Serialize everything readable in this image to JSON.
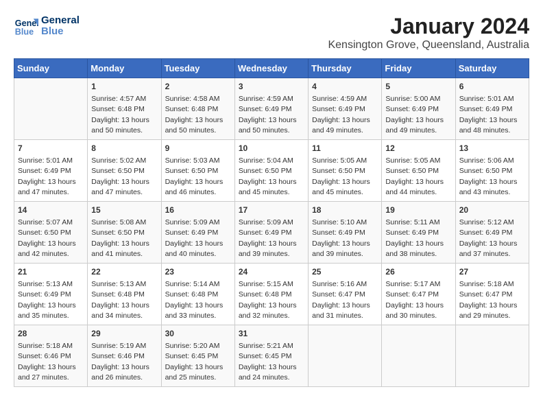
{
  "logo": {
    "line1": "General",
    "line2": "Blue"
  },
  "title": "January 2024",
  "subtitle": "Kensington Grove, Queensland, Australia",
  "weekdays": [
    "Sunday",
    "Monday",
    "Tuesday",
    "Wednesday",
    "Thursday",
    "Friday",
    "Saturday"
  ],
  "weeks": [
    [
      {
        "day": "",
        "info": ""
      },
      {
        "day": "1",
        "info": "Sunrise: 4:57 AM\nSunset: 6:48 PM\nDaylight: 13 hours\nand 50 minutes."
      },
      {
        "day": "2",
        "info": "Sunrise: 4:58 AM\nSunset: 6:48 PM\nDaylight: 13 hours\nand 50 minutes."
      },
      {
        "day": "3",
        "info": "Sunrise: 4:59 AM\nSunset: 6:49 PM\nDaylight: 13 hours\nand 50 minutes."
      },
      {
        "day": "4",
        "info": "Sunrise: 4:59 AM\nSunset: 6:49 PM\nDaylight: 13 hours\nand 49 minutes."
      },
      {
        "day": "5",
        "info": "Sunrise: 5:00 AM\nSunset: 6:49 PM\nDaylight: 13 hours\nand 49 minutes."
      },
      {
        "day": "6",
        "info": "Sunrise: 5:01 AM\nSunset: 6:49 PM\nDaylight: 13 hours\nand 48 minutes."
      }
    ],
    [
      {
        "day": "7",
        "info": "Sunrise: 5:01 AM\nSunset: 6:49 PM\nDaylight: 13 hours\nand 47 minutes."
      },
      {
        "day": "8",
        "info": "Sunrise: 5:02 AM\nSunset: 6:50 PM\nDaylight: 13 hours\nand 47 minutes."
      },
      {
        "day": "9",
        "info": "Sunrise: 5:03 AM\nSunset: 6:50 PM\nDaylight: 13 hours\nand 46 minutes."
      },
      {
        "day": "10",
        "info": "Sunrise: 5:04 AM\nSunset: 6:50 PM\nDaylight: 13 hours\nand 45 minutes."
      },
      {
        "day": "11",
        "info": "Sunrise: 5:05 AM\nSunset: 6:50 PM\nDaylight: 13 hours\nand 45 minutes."
      },
      {
        "day": "12",
        "info": "Sunrise: 5:05 AM\nSunset: 6:50 PM\nDaylight: 13 hours\nand 44 minutes."
      },
      {
        "day": "13",
        "info": "Sunrise: 5:06 AM\nSunset: 6:50 PM\nDaylight: 13 hours\nand 43 minutes."
      }
    ],
    [
      {
        "day": "14",
        "info": "Sunrise: 5:07 AM\nSunset: 6:50 PM\nDaylight: 13 hours\nand 42 minutes."
      },
      {
        "day": "15",
        "info": "Sunrise: 5:08 AM\nSunset: 6:50 PM\nDaylight: 13 hours\nand 41 minutes."
      },
      {
        "day": "16",
        "info": "Sunrise: 5:09 AM\nSunset: 6:49 PM\nDaylight: 13 hours\nand 40 minutes."
      },
      {
        "day": "17",
        "info": "Sunrise: 5:09 AM\nSunset: 6:49 PM\nDaylight: 13 hours\nand 39 minutes."
      },
      {
        "day": "18",
        "info": "Sunrise: 5:10 AM\nSunset: 6:49 PM\nDaylight: 13 hours\nand 39 minutes."
      },
      {
        "day": "19",
        "info": "Sunrise: 5:11 AM\nSunset: 6:49 PM\nDaylight: 13 hours\nand 38 minutes."
      },
      {
        "day": "20",
        "info": "Sunrise: 5:12 AM\nSunset: 6:49 PM\nDaylight: 13 hours\nand 37 minutes."
      }
    ],
    [
      {
        "day": "21",
        "info": "Sunrise: 5:13 AM\nSunset: 6:49 PM\nDaylight: 13 hours\nand 35 minutes."
      },
      {
        "day": "22",
        "info": "Sunrise: 5:13 AM\nSunset: 6:48 PM\nDaylight: 13 hours\nand 34 minutes."
      },
      {
        "day": "23",
        "info": "Sunrise: 5:14 AM\nSunset: 6:48 PM\nDaylight: 13 hours\nand 33 minutes."
      },
      {
        "day": "24",
        "info": "Sunrise: 5:15 AM\nSunset: 6:48 PM\nDaylight: 13 hours\nand 32 minutes."
      },
      {
        "day": "25",
        "info": "Sunrise: 5:16 AM\nSunset: 6:47 PM\nDaylight: 13 hours\nand 31 minutes."
      },
      {
        "day": "26",
        "info": "Sunrise: 5:17 AM\nSunset: 6:47 PM\nDaylight: 13 hours\nand 30 minutes."
      },
      {
        "day": "27",
        "info": "Sunrise: 5:18 AM\nSunset: 6:47 PM\nDaylight: 13 hours\nand 29 minutes."
      }
    ],
    [
      {
        "day": "28",
        "info": "Sunrise: 5:18 AM\nSunset: 6:46 PM\nDaylight: 13 hours\nand 27 minutes."
      },
      {
        "day": "29",
        "info": "Sunrise: 5:19 AM\nSunset: 6:46 PM\nDaylight: 13 hours\nand 26 minutes."
      },
      {
        "day": "30",
        "info": "Sunrise: 5:20 AM\nSunset: 6:45 PM\nDaylight: 13 hours\nand 25 minutes."
      },
      {
        "day": "31",
        "info": "Sunrise: 5:21 AM\nSunset: 6:45 PM\nDaylight: 13 hours\nand 24 minutes."
      },
      {
        "day": "",
        "info": ""
      },
      {
        "day": "",
        "info": ""
      },
      {
        "day": "",
        "info": ""
      }
    ]
  ]
}
